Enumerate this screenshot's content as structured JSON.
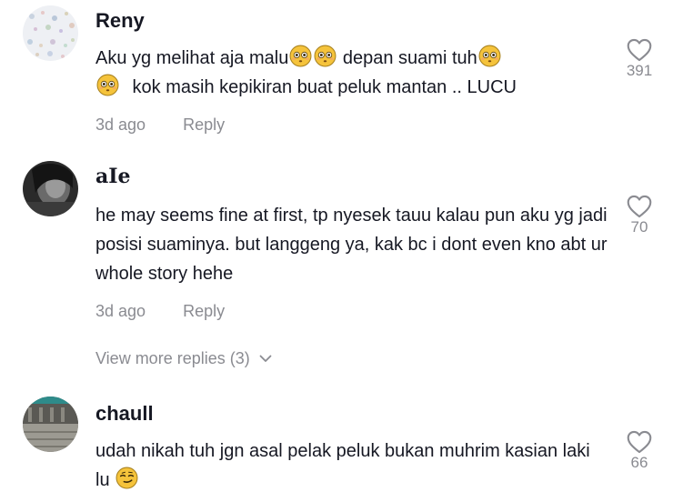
{
  "comments": [
    {
      "username": "Reny",
      "text_parts": [
        "Aku yg melihat aja malu",
        " depan suami tuh",
        " kok masih kepikiran buat peluk mantan .. LUCU"
      ],
      "time": "3d ago",
      "reply_label": "Reply",
      "likes": "391"
    },
    {
      "username": "aIe",
      "text": "he may seems fine at first, tp nyesek tauu kalau pun aku yg jadi posisi suaminya. but langgeng ya, kak bc i dont even kno abt ur whole story hehe",
      "time": "3d ago",
      "reply_label": "Reply",
      "likes": "70"
    },
    {
      "username": "chaull",
      "text_parts": [
        "udah nikah tuh jgn asal pelak peluk bukan muhrim kasian laki lu "
      ],
      "likes": "66"
    }
  ],
  "view_more_label": "View more replies (3)",
  "icons": {
    "heart": "heart-icon",
    "chevron": "chevron-down-icon",
    "flushed": "flushed-face-emoji",
    "smirk": "smirking-face-emoji"
  },
  "colors": {
    "secondary_text": "#8a8b91",
    "primary_text": "#161823",
    "emoji_yellow": "#f5c33b"
  }
}
